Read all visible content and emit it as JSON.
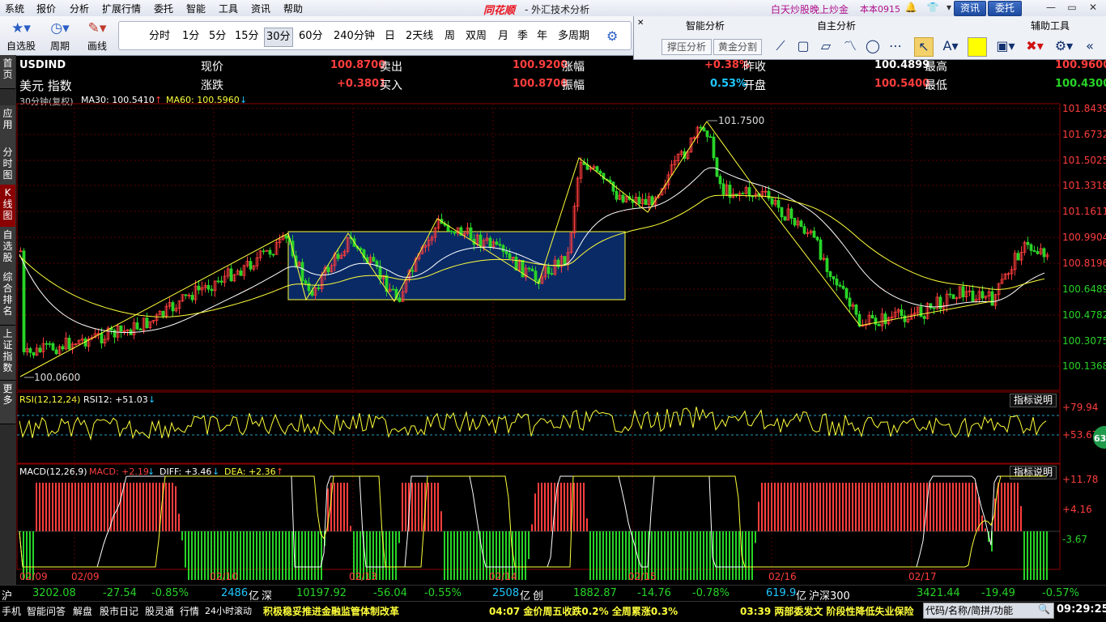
{
  "menu": [
    "系统",
    "报价",
    "分析",
    "扩展行情",
    "委托",
    "智能",
    "工具",
    "资讯",
    "帮助"
  ],
  "brand": "同花顺",
  "app_title": "- 外汇技术分析",
  "promo": "白天炒股晚上炒金",
  "version": "本本0915",
  "top_buttons": {
    "news": "资讯",
    "trade": "委托"
  },
  "toolbar": {
    "watchlist": "自选股",
    "period": "周期",
    "draw": "画线"
  },
  "periods": [
    "分时",
    "1分",
    "5分",
    "15分",
    "30分",
    "60分",
    "240分钟",
    "日",
    "2天线",
    "周",
    "双周",
    "月",
    "季",
    "年",
    "多周期"
  ],
  "selected_period": "30分",
  "right_panel": {
    "smart": "智能分析",
    "self": "自主分析",
    "aux": "辅助工具",
    "btn_press": "撑压分析",
    "btn_gold": "黄金分割"
  },
  "left_tabs": [
    "首页",
    "应用",
    "分时图",
    "K线图",
    "自选股",
    "综合排名",
    "上证指数",
    "更多"
  ],
  "quote": {
    "symbol": "USDIND",
    "name": "美元 指数",
    "labels": {
      "now": "现价",
      "change": "涨跌",
      "sell": "卖出",
      "buy": "买入",
      "pct": "涨幅",
      "amp": "振幅",
      "prev": "昨收",
      "open": "开盘",
      "high": "最高",
      "low": "最低"
    },
    "now": "100.8700",
    "change": "+0.3801",
    "sell": "100.9200",
    "buy": "100.8700",
    "pct": "+0.38%",
    "amp": "0.53%",
    "prev": "100.4899",
    "open": "100.5400",
    "high": "100.9600",
    "low": "100.4300"
  },
  "kline": {
    "period_label": "30分钟(复权)",
    "ma30": "MA30: 100.5410",
    "ma60": "MA60: 100.5960",
    "price_ticks": [
      "101.8439",
      "101.6732",
      "101.5025",
      "101.3318",
      "101.1611",
      "100.9904",
      "100.8196",
      "100.6489",
      "100.4782",
      "100.3075",
      "100.1368"
    ],
    "hi_mark": "101.7500",
    "lo_mark": "100.0600"
  },
  "rsi": {
    "label": "RSI(12,12,24)",
    "value": "RSI12: +51.03",
    "explain": "指标说明",
    "ticks": [
      "+79.94",
      "+53.67"
    ],
    "badge": "63"
  },
  "macd": {
    "label": "MACD(12,26,9)",
    "macd": "MACD: +2.19",
    "diff": "DIFF: +3.46",
    "dea": "DEA: +2.36",
    "explain": "指标说明",
    "ticks": [
      "+11.78",
      "+4.16",
      "-3.67"
    ]
  },
  "dates": [
    "02/09",
    "02/09",
    "02/10",
    "02/13",
    "02/14",
    "02/15",
    "02/16",
    "02/17"
  ],
  "status1": {
    "sh": "沪",
    "sh_val": "3202.08",
    "sh_chg": "-27.54",
    "sh_pct": "-0.85%",
    "sh_amt": "2486",
    "unit": "亿",
    "sz": "深",
    "sz_val": "10197.92",
    "sz_chg": "-56.04",
    "sz_pct": "-0.55%",
    "sz_amt": "2508",
    "cy": "创",
    "cy_val": "1882.87",
    "cy_chg": "-14.76",
    "cy_pct": "-0.78%",
    "hs_amt": "619.9",
    "hs": "沪深300",
    "hs_val": "3421.44",
    "hs_chg": "-19.49",
    "hs_pct": "-0.57%"
  },
  "status2": {
    "tabs": [
      "手机",
      "智能问答",
      "解盘",
      "股市日记",
      "股灵通",
      "行情",
      "24小时滚动"
    ],
    "news1": "积极稳妥推进金融监管体制改革",
    "news2": "04:07 金价周五收跌0.2% 全周累涨0.3%",
    "news3": "03:39 两部委发文 阶段性降低失业保险",
    "code_box": "代码/名称/简拼/功能",
    "time": "09:29:25"
  },
  "colors": {
    "up": "#ff3d3d",
    "down": "#28d428",
    "box": "#0a2a66",
    "yellow": "#ffff3a"
  }
}
